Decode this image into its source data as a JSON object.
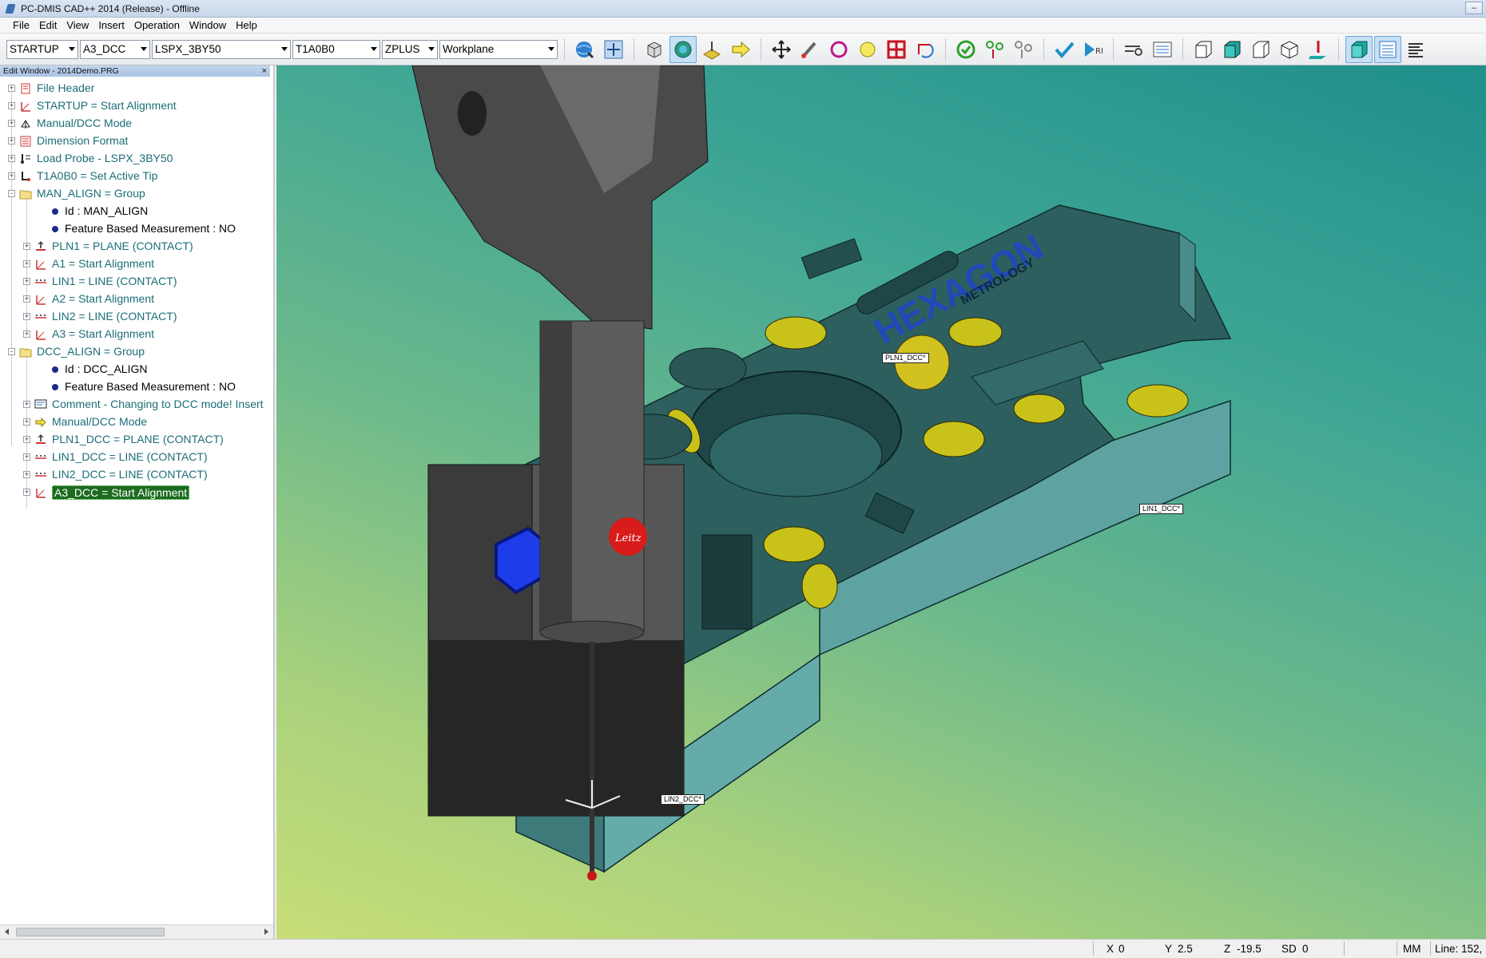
{
  "window": {
    "title": "PC-DMIS CAD++ 2014 (Release) - Offline",
    "minimize_label": "‒"
  },
  "menu": [
    "File",
    "Edit",
    "View",
    "Insert",
    "Operation",
    "Window",
    "Help"
  ],
  "toolbar": {
    "combos": {
      "alignment": "STARTUP",
      "alignment2": "A3_DCC",
      "probe": "LSPX_3BY50",
      "tip": "T1A0B0",
      "view": "ZPLUS",
      "workplane": "Workplane"
    },
    "icons": [
      "globe-icon",
      "zoom-fit-icon",
      "cube-wire-icon",
      "solid-globe-icon",
      "probe-toggle-icon",
      "arrow-right-icon",
      "translate-icon",
      "probe-pen-icon",
      "circle-feature-icon",
      "sphere-feature-icon",
      "grid-icon",
      "rotate-icon",
      "refresh-green-icon",
      "touch-points-icon",
      "touch-points-gray-icon",
      "checkmark-icon",
      "run-icon",
      "measure-icon",
      "report-icon",
      "view-front-icon",
      "view-side-icon",
      "view-back-icon",
      "view-iso-icon",
      "probe-red-icon",
      "solid-view-icon",
      "list-view-icon",
      "text-view-icon"
    ]
  },
  "edit_window": {
    "title": "Edit Window - 2014Demo.PRG",
    "close_label": "×",
    "items": [
      {
        "label": "File Header",
        "icon": "file-header-icon"
      },
      {
        "label": "STARTUP = Start Alignment",
        "icon": "alignment-icon"
      },
      {
        "label": "Manual/DCC Mode",
        "icon": "mode-icon"
      },
      {
        "label": "Dimension Format",
        "icon": "dimension-format-icon"
      },
      {
        "label": "Load Probe - LSPX_3BY50",
        "icon": "load-probe-icon"
      },
      {
        "label": "T1A0B0 = Set Active Tip",
        "icon": "active-tip-icon"
      },
      {
        "label": "MAN_ALIGN = Group",
        "icon": "folder-icon"
      },
      {
        "label": "Id : MAN_ALIGN",
        "icon": "dot-icon"
      },
      {
        "label": "Feature Based Measurement : NO",
        "icon": "dot-icon"
      },
      {
        "label": "PLN1 = PLANE (CONTACT)",
        "icon": "plane-icon"
      },
      {
        "label": "A1 = Start Alignment",
        "icon": "alignment-icon"
      },
      {
        "label": "LIN1 = LINE (CONTACT)",
        "icon": "line-icon"
      },
      {
        "label": "A2 = Start Alignment",
        "icon": "alignment-icon"
      },
      {
        "label": "LIN2 = LINE (CONTACT)",
        "icon": "line-icon"
      },
      {
        "label": "A3 = Start Alignment",
        "icon": "alignment-icon"
      },
      {
        "label": "DCC_ALIGN = Group",
        "icon": "folder-icon"
      },
      {
        "label": "Id : DCC_ALIGN",
        "icon": "dot-icon"
      },
      {
        "label": "Feature Based Measurement : NO",
        "icon": "dot-icon"
      },
      {
        "label": "Comment - Changing to DCC mode! Insert",
        "icon": "comment-icon"
      },
      {
        "label": "Manual/DCC Mode",
        "icon": "mode-arrow-icon"
      },
      {
        "label": "PLN1_DCC = PLANE (CONTACT)",
        "icon": "plane-icon"
      },
      {
        "label": "LIN1_DCC = LINE (CONTACT)",
        "icon": "line-icon"
      },
      {
        "label": "LIN2_DCC = LINE (CONTACT)",
        "icon": "line-icon"
      },
      {
        "label": "A3_DCC = Start Alignment",
        "icon": "alignment-icon"
      }
    ]
  },
  "graphics": {
    "feature_labels": {
      "pln1_dcc": "PLN1_DCC*",
      "lin1_dcc": "LIN1_DCC*",
      "lin2_dcc": "LIN2_DCC*"
    },
    "brand_text": "HEXAGON",
    "brand_subtext": "METROLOGY",
    "probe_badge": "Leitz"
  },
  "status": {
    "x_label": "X",
    "x_value": "0",
    "y_label": "Y",
    "y_value": "2.5",
    "z_label": "Z",
    "z_value": "-19.5",
    "sd_label": "SD",
    "sd_value": "0",
    "units": "MM",
    "line": "Line: 152,"
  },
  "colors": {
    "tree_text": "#1b6e77",
    "selection": "#1c6b1e",
    "part_top": "#2b5a5a",
    "part_side": "#5a9f9e",
    "holes": "#c9c21a"
  }
}
